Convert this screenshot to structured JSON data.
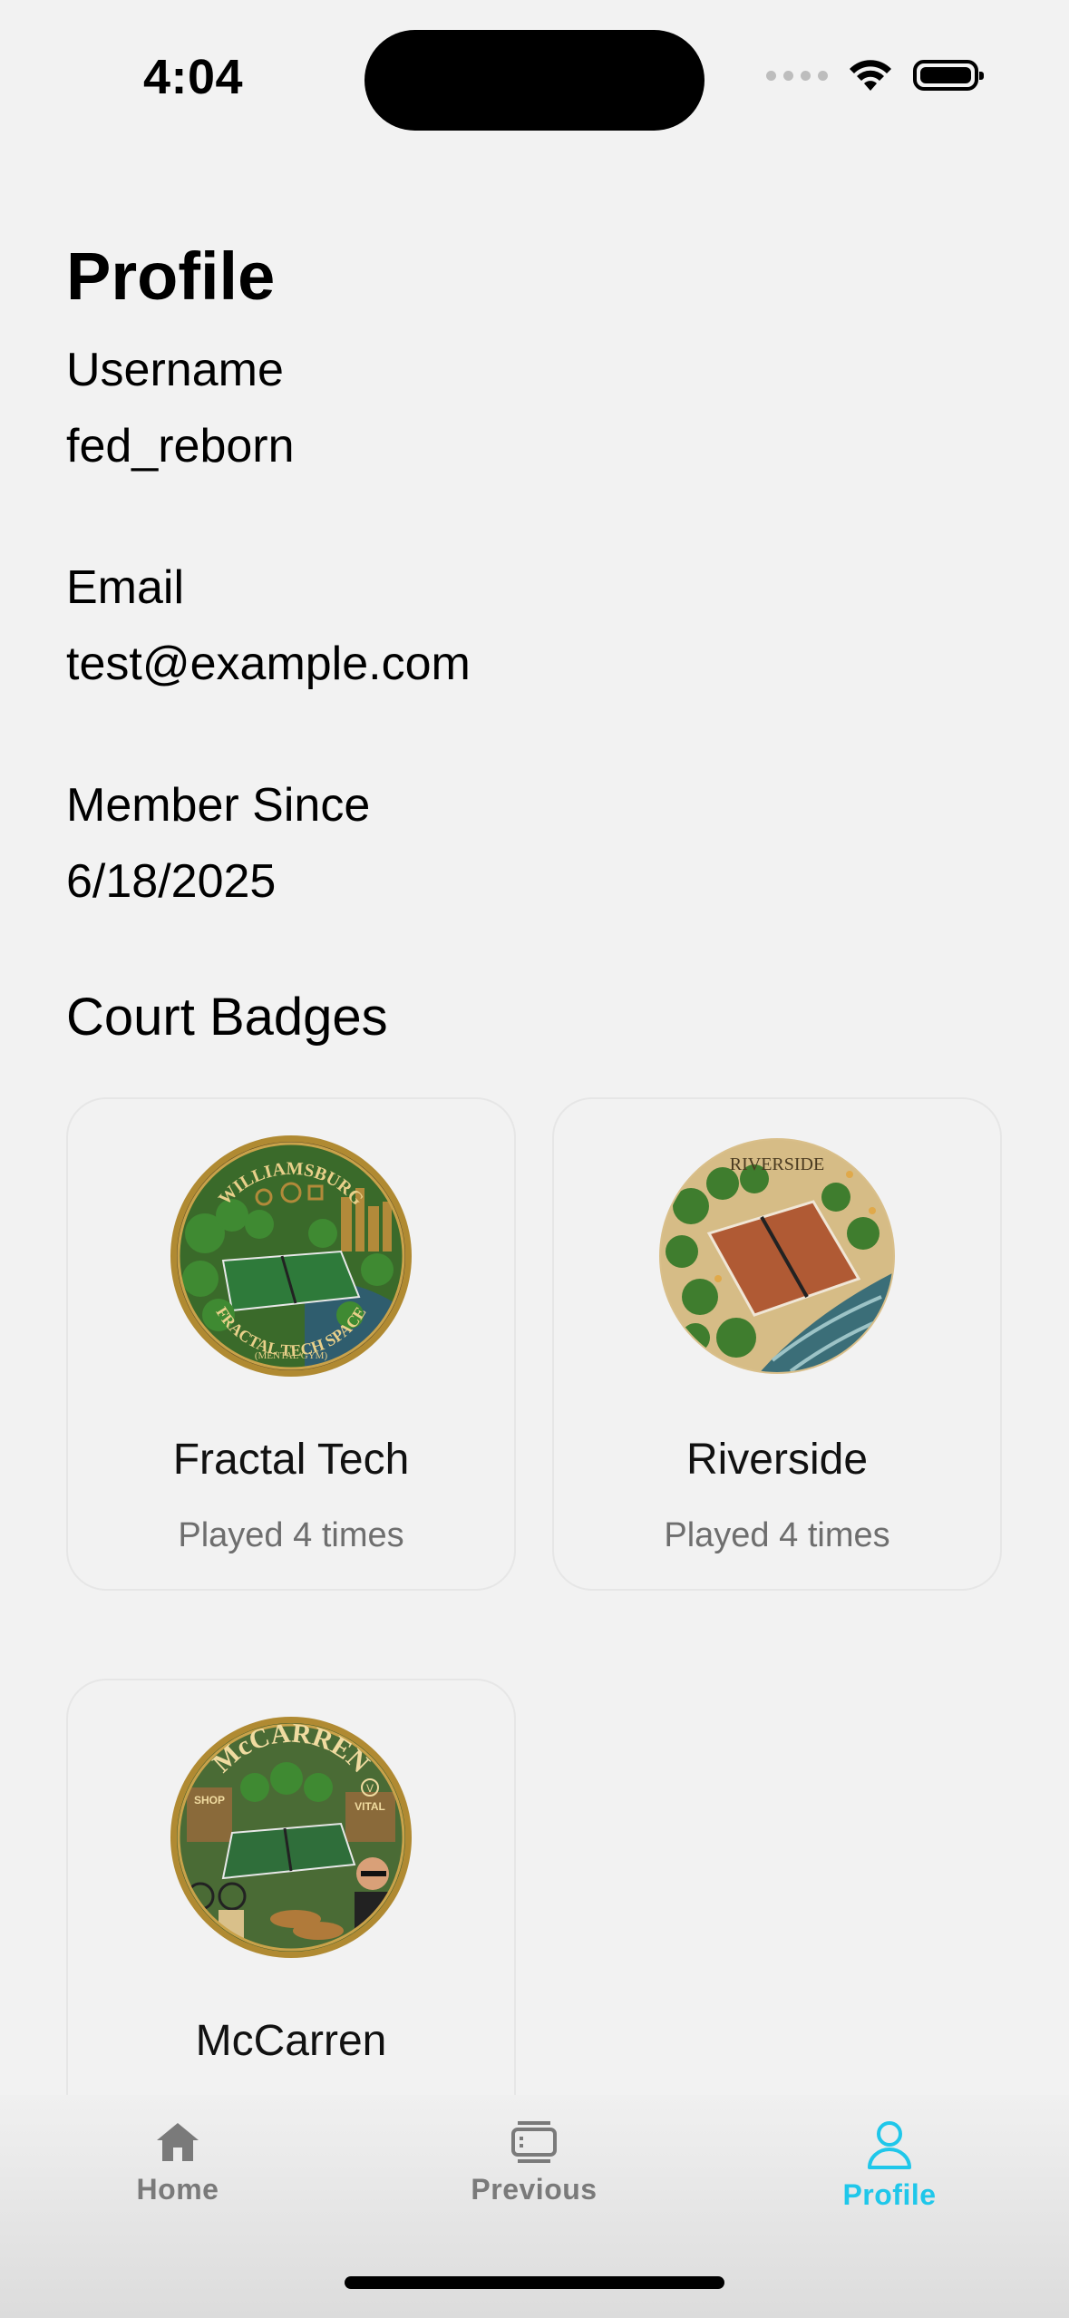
{
  "status_bar": {
    "time": "4:04"
  },
  "profile": {
    "title": "Profile",
    "fields": [
      {
        "label": "Username",
        "value": "fed_reborn"
      },
      {
        "label": "Email",
        "value": "test@example.com"
      },
      {
        "label": "Member Since",
        "value": "6/18/2025"
      }
    ]
  },
  "badges": {
    "title": "Court Badges",
    "items": [
      {
        "name": "Fractal Tech",
        "played": "Played 4 times",
        "art_text_top": "WILLIAMSBURG",
        "art_text_bottom": "FRACTAL TECH SPACE",
        "art_text_sub": "(MENTAL GYM)"
      },
      {
        "name": "Riverside",
        "played": "Played 4 times",
        "art_text_top": "RIVERSIDE"
      },
      {
        "name": "McCarren",
        "played": "",
        "art_text_top": "McCARREN",
        "art_text_shop": "SHOP",
        "art_text_vital": "VITAL",
        "art_text_v": "V"
      }
    ]
  },
  "tabbar": {
    "tabs": [
      {
        "label": "Home",
        "icon": "house-icon",
        "active": false
      },
      {
        "label": "Previous",
        "icon": "list-icon",
        "active": false
      },
      {
        "label": "Profile",
        "icon": "person-icon",
        "active": true
      }
    ],
    "active_color": "#1fc7ea",
    "inactive_color": "#7a7a7a"
  }
}
